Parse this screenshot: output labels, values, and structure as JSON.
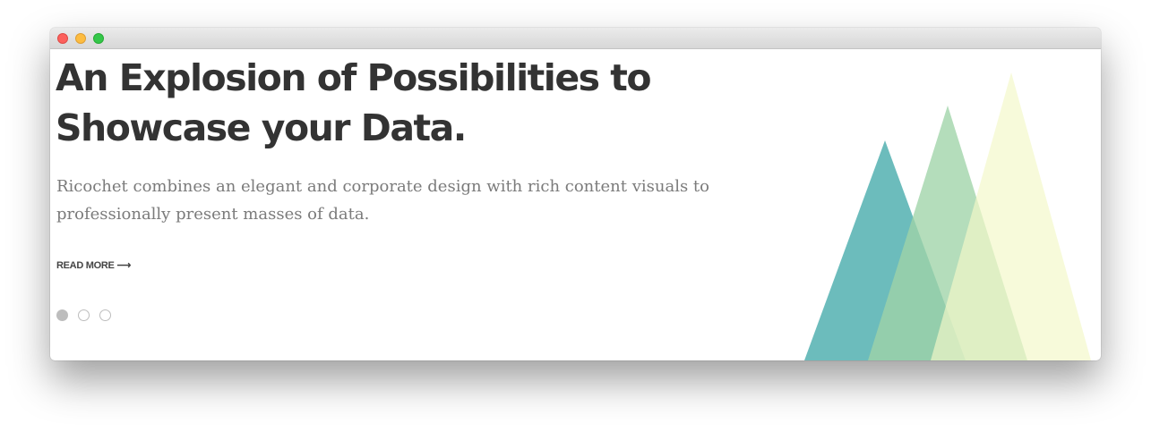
{
  "window": {
    "controls": [
      "close",
      "minimize",
      "maximize"
    ]
  },
  "hero": {
    "headline_line1": "An Explosion of Possibilities to",
    "headline_line2": "Showcase your Data.",
    "subtext": "Ricochet combines an elegant and corporate design with rich content visuals to professionally present masses of data.",
    "read_more_label": "READ MORE",
    "read_more_arrow": "⟶"
  },
  "slider": {
    "slide_count": 3,
    "active_index": 0
  },
  "decoration": {
    "icon": "triangles-graphic",
    "colors": [
      "#5fb6b6",
      "#9fd4a8",
      "#f6fbd2"
    ]
  }
}
